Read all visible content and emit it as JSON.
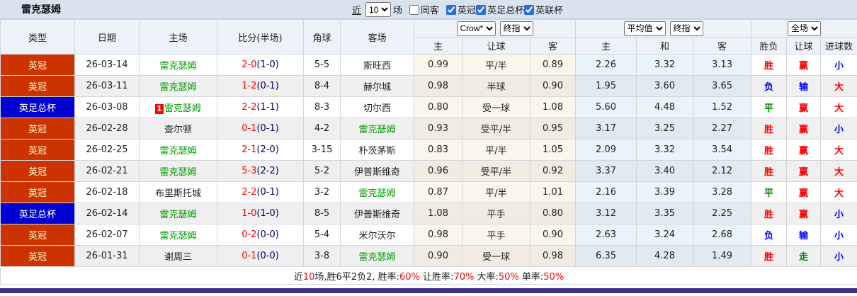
{
  "title": "雷克瑟姆",
  "toolbar": {
    "near_label": "近",
    "match_count": "10",
    "matches_label": "场",
    "same_away": {
      "label": "同客",
      "checked": false
    },
    "leagues": [
      {
        "label": "英冠",
        "checked": true
      },
      {
        "label": "英足总杯",
        "checked": true
      },
      {
        "label": "英联杯",
        "checked": true
      }
    ]
  },
  "header": {
    "type": "类型",
    "date": "日期",
    "home": "主场",
    "score": "比分(半场)",
    "corner": "角球",
    "away": "客场",
    "odds": {
      "company_select": "Crow*",
      "stage_select": "终指",
      "cols": [
        "主",
        "让球",
        "客"
      ]
    },
    "avg": {
      "company_select": "平均值",
      "stage_select": "终指",
      "cols": [
        "主",
        "和",
        "客"
      ]
    },
    "result": {
      "scope_select": "全场",
      "cols": [
        "胜负",
        "让球",
        "进球数"
      ]
    }
  },
  "rows": [
    {
      "league": "英冠",
      "league_color": "red",
      "date": "26-03-14",
      "badge": "",
      "home": "雷克瑟姆",
      "home_self": true,
      "ft": "2-0",
      "ht": "(1-0)",
      "corners": "5-5",
      "away": "斯旺西",
      "away_self": false,
      "odds_home": "0.99",
      "handicap": "平/半",
      "odds_away": "0.89",
      "avg_home": "2.26",
      "avg_draw": "3.32",
      "avg_away": "3.13",
      "r1": {
        "t": "胜",
        "c": "red"
      },
      "r2": {
        "t": "赢",
        "c": "red"
      },
      "r3": {
        "t": "小",
        "c": "blue"
      }
    },
    {
      "league": "英冠",
      "league_color": "red",
      "date": "26-03-11",
      "badge": "",
      "home": "雷克瑟姆",
      "home_self": true,
      "ft": "1-2",
      "ht": "(0-1)",
      "corners": "8-4",
      "away": "赫尔城",
      "away_self": false,
      "odds_home": "0.98",
      "handicap": "半球",
      "odds_away": "0.90",
      "avg_home": "1.95",
      "avg_draw": "3.60",
      "avg_away": "3.65",
      "r1": {
        "t": "负",
        "c": "blue"
      },
      "r2": {
        "t": "输",
        "c": "blue"
      },
      "r3": {
        "t": "大",
        "c": "red"
      }
    },
    {
      "league": "英足总杯",
      "league_color": "blue",
      "date": "26-03-08",
      "badge": "1",
      "home": "雷克瑟姆",
      "home_self": true,
      "ft": "2-2",
      "ht": "(1-1)",
      "corners": "8-3",
      "away": "切尔西",
      "away_self": false,
      "odds_home": "0.80",
      "handicap": "受一球",
      "odds_away": "1.08",
      "avg_home": "5.60",
      "avg_draw": "4.48",
      "avg_away": "1.52",
      "r1": {
        "t": "平",
        "c": "green"
      },
      "r2": {
        "t": "赢",
        "c": "red"
      },
      "r3": {
        "t": "大",
        "c": "red"
      }
    },
    {
      "league": "英冠",
      "league_color": "red",
      "date": "26-02-28",
      "badge": "",
      "home": "查尔顿",
      "home_self": false,
      "ft": "0-1",
      "ht": "(0-1)",
      "corners": "4-2",
      "away": "雷克瑟姆",
      "away_self": true,
      "odds_home": "0.93",
      "handicap": "受平/半",
      "odds_away": "0.95",
      "avg_home": "3.17",
      "avg_draw": "3.25",
      "avg_away": "2.27",
      "r1": {
        "t": "胜",
        "c": "red"
      },
      "r2": {
        "t": "赢",
        "c": "red"
      },
      "r3": {
        "t": "小",
        "c": "blue"
      }
    },
    {
      "league": "英冠",
      "league_color": "red",
      "date": "26-02-25",
      "badge": "",
      "home": "雷克瑟姆",
      "home_self": true,
      "ft": "2-1",
      "ht": "(2-0)",
      "corners": "3-15",
      "away": "朴茨茅斯",
      "away_self": false,
      "odds_home": "0.83",
      "handicap": "平/半",
      "odds_away": "1.05",
      "avg_home": "2.09",
      "avg_draw": "3.32",
      "avg_away": "3.54",
      "r1": {
        "t": "胜",
        "c": "red"
      },
      "r2": {
        "t": "赢",
        "c": "red"
      },
      "r3": {
        "t": "大",
        "c": "red"
      }
    },
    {
      "league": "英冠",
      "league_color": "red",
      "date": "26-02-21",
      "badge": "",
      "home": "雷克瑟姆",
      "home_self": true,
      "ft": "5-3",
      "ht": "(2-2)",
      "corners": "5-2",
      "away": "伊普斯维奇",
      "away_self": false,
      "odds_home": "0.96",
      "handicap": "受平/半",
      "odds_away": "0.92",
      "avg_home": "3.37",
      "avg_draw": "3.40",
      "avg_away": "2.12",
      "r1": {
        "t": "胜",
        "c": "red"
      },
      "r2": {
        "t": "赢",
        "c": "red"
      },
      "r3": {
        "t": "大",
        "c": "red"
      }
    },
    {
      "league": "英冠",
      "league_color": "red",
      "date": "26-02-18",
      "badge": "",
      "home": "布里斯托城",
      "home_self": false,
      "ft": "2-2",
      "ht": "(0-1)",
      "corners": "3-2",
      "away": "雷克瑟姆",
      "away_self": true,
      "odds_home": "0.87",
      "handicap": "平/半",
      "odds_away": "1.01",
      "avg_home": "2.16",
      "avg_draw": "3.39",
      "avg_away": "3.28",
      "r1": {
        "t": "平",
        "c": "green"
      },
      "r2": {
        "t": "赢",
        "c": "red"
      },
      "r3": {
        "t": "大",
        "c": "red"
      }
    },
    {
      "league": "英足总杯",
      "league_color": "blue",
      "date": "26-02-14",
      "badge": "",
      "home": "雷克瑟姆",
      "home_self": true,
      "ft": "1-0",
      "ht": "(1-0)",
      "corners": "8-5",
      "away": "伊普斯维奇",
      "away_self": false,
      "odds_home": "1.08",
      "handicap": "平手",
      "odds_away": "0.80",
      "avg_home": "3.12",
      "avg_draw": "3.35",
      "avg_away": "2.25",
      "r1": {
        "t": "胜",
        "c": "red"
      },
      "r2": {
        "t": "赢",
        "c": "red"
      },
      "r3": {
        "t": "小",
        "c": "blue"
      }
    },
    {
      "league": "英冠",
      "league_color": "red",
      "date": "26-02-07",
      "badge": "",
      "home": "雷克瑟姆",
      "home_self": true,
      "ft": "0-2",
      "ht": "(0-0)",
      "corners": "5-4",
      "away": "米尔沃尔",
      "away_self": false,
      "odds_home": "0.98",
      "handicap": "平手",
      "odds_away": "0.90",
      "avg_home": "2.63",
      "avg_draw": "3.24",
      "avg_away": "2.68",
      "r1": {
        "t": "负",
        "c": "blue"
      },
      "r2": {
        "t": "输",
        "c": "blue"
      },
      "r3": {
        "t": "小",
        "c": "blue"
      }
    },
    {
      "league": "英冠",
      "league_color": "red",
      "date": "26-01-31",
      "badge": "",
      "home": "谢周三",
      "home_self": false,
      "ft": "0-1",
      "ht": "(0-0)",
      "corners": "3-8",
      "away": "雷克瑟姆",
      "away_self": true,
      "odds_home": "0.90",
      "handicap": "受一球",
      "odds_away": "0.98",
      "avg_home": "6.35",
      "avg_draw": "4.28",
      "avg_away": "1.49",
      "r1": {
        "t": "胜",
        "c": "red"
      },
      "r2": {
        "t": "走",
        "c": "green"
      },
      "r3": {
        "t": "小",
        "c": "blue"
      }
    }
  ],
  "footer": {
    "segments": [
      {
        "text": "近",
        "color": "black"
      },
      {
        "text": "10",
        "color": "red"
      },
      {
        "text": "场,胜6平2负2, 胜率:",
        "color": "black"
      },
      {
        "text": "60%",
        "color": "red"
      },
      {
        "text": " 让胜率:",
        "color": "black"
      },
      {
        "text": "70%",
        "color": "red"
      },
      {
        "text": " 大率:",
        "color": "black"
      },
      {
        "text": "50%",
        "color": "red"
      },
      {
        "text": " 单率:",
        "color": "black"
      },
      {
        "text": "50%",
        "color": "red"
      }
    ]
  },
  "colors": {
    "league_red_bg": "#cc3300",
    "league_blue_bg": "#0000d0",
    "self_team_green": "#009900",
    "score_red": "#ff0000",
    "halftime_navy": "#000066",
    "titlebar_bg": "#d9e3ef",
    "odds_col_bg": "#fbf6ec",
    "avg_col_bg": "#e9f3fa",
    "bottom_bar": "#3d2f87"
  }
}
